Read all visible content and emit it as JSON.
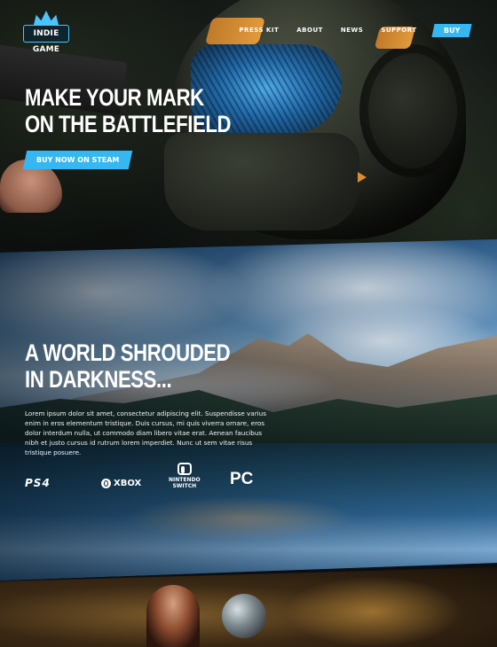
{
  "brand": {
    "logo_text": "INDIE GAME"
  },
  "nav": {
    "links": [
      "PRESS KIT",
      "ABOUT",
      "NEWS",
      "SUPPORT"
    ],
    "buy_label": "BUY"
  },
  "hero": {
    "title_line1": "MAKE YOUR MARK",
    "title_line2": "ON THE BATTLEFIELD",
    "cta_label": "BUY NOW ON STEAM"
  },
  "world": {
    "title_line1": "A WORLD SHROUDED",
    "title_line2": "IN DARKNESS...",
    "body": "Lorem ipsum dolor sit amet, consectetur adipiscing elit. Suspendisse varius enim in eros elementum tristique. Duis cursus, mi quis viverra ornare, eros dolor interdum nulla, ut commodo diam libero vitae erat. Aenean faucibus nibh et justo cursus id rutrum lorem imperdiet. Nunc ut sem vitae risus tristique posuere.",
    "platforms": {
      "ps4": "PS4",
      "xbox": "XBOX",
      "switch_top": "NINTENDO",
      "switch_bottom": "SWITCH",
      "pc": "PC"
    }
  },
  "colors": {
    "accent": "#36b7f2",
    "text": "#ffffff"
  }
}
